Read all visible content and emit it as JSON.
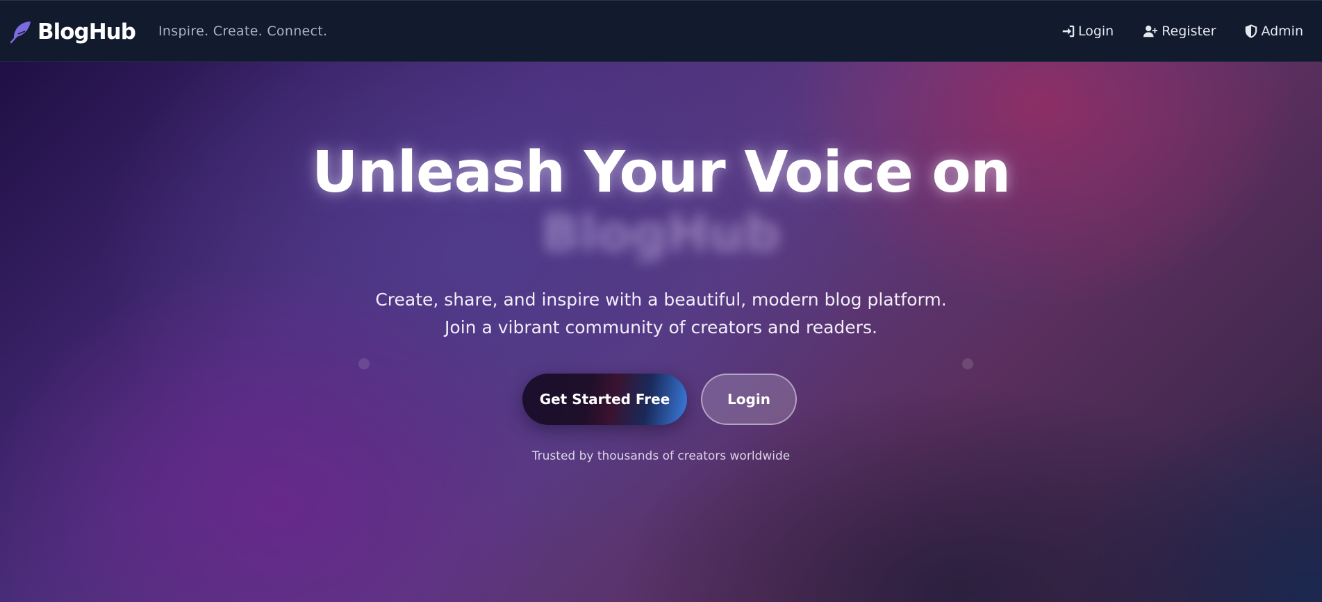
{
  "navbar": {
    "brand_name": "BlogHub",
    "brand_icon": "feather-icon",
    "tagline": "Inspire. Create. Connect.",
    "links": [
      {
        "label": "Login",
        "icon": "sign-in-icon"
      },
      {
        "label": "Register",
        "icon": "user-plus-icon"
      },
      {
        "label": "Admin",
        "icon": "shield-icon"
      }
    ]
  },
  "hero": {
    "title": "Unleash Your Voice on",
    "title_blurred": "BlogHub",
    "subtitle_line1": "Create, share, and inspire with a beautiful, modern blog platform.",
    "subtitle_line2": "Join a vibrant community of creators and readers.",
    "primary_cta": "Get Started Free",
    "secondary_cta": "Login",
    "trusted_text": "Trusted by thousands of creators worldwide"
  },
  "colors": {
    "navbar_bg": "#121a2e",
    "brand_icon": "#7c6be0",
    "accent_blue": "#3b7de0"
  }
}
